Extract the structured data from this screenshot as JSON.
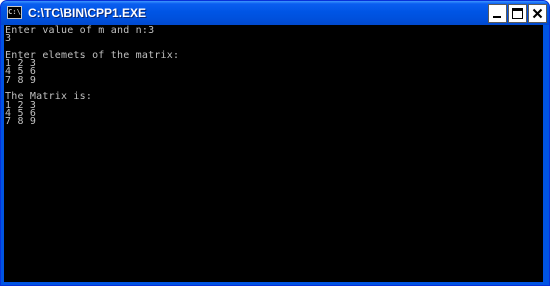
{
  "window": {
    "title": "C:\\TC\\BIN\\CPP1.EXE",
    "icon": "console-icon",
    "controls": {
      "minimize": "minimize-icon",
      "maximize": "maximize-icon",
      "close": "close-icon"
    }
  },
  "console": {
    "output": "Enter value of m and n:3\n3\n\nEnter elemets of the matrix:\n1 2 3\n4 5 6\n7 8 9\n\nThe Matrix is:\n1 2 3\n4 5 6\n7 8 9"
  },
  "colors": {
    "titlebar": "#0054e3",
    "console_background": "#000000",
    "console_text": "#c0c0c0",
    "close_button": "#d6492b"
  }
}
